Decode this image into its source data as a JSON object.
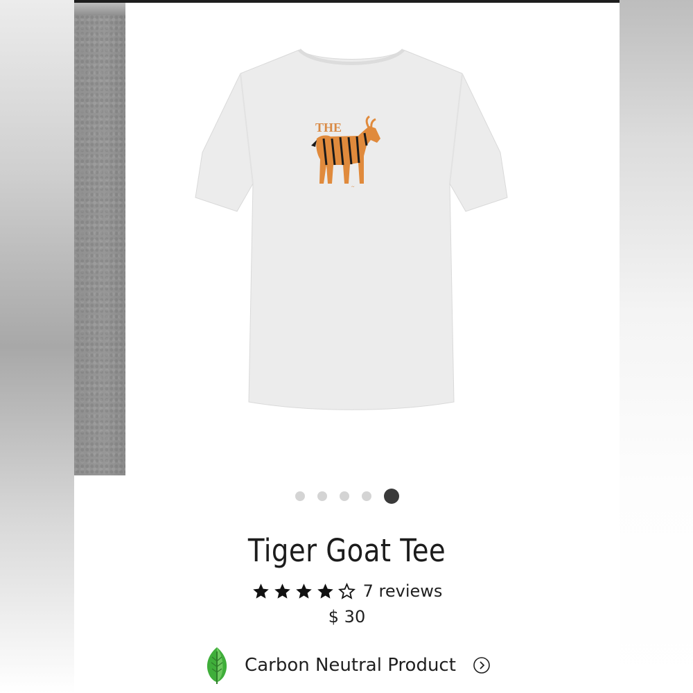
{
  "product": {
    "title": "Tiger Goat Tee",
    "rating": 4,
    "rating_max": 5,
    "reviews_label": "7 reviews",
    "price": "$ 30"
  },
  "gallery": {
    "dot_count": 5,
    "active_index": 4,
    "shirt_print_text": "THE",
    "shirt_color": "#ececec",
    "print_color": "#e08a3c"
  },
  "carbon": {
    "label": "Carbon Neutral Product",
    "leaf_icon": "leaf-icon",
    "arrow_icon": "chevron-right-circle-icon"
  }
}
